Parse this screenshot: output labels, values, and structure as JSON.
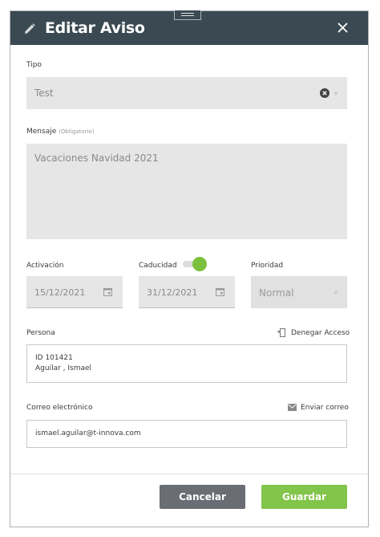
{
  "header": {
    "title": "Editar Aviso",
    "icon": "pencil-icon",
    "close_icon": "close-icon",
    "bg_color": "#3b4a52"
  },
  "tipo": {
    "label": "Tipo",
    "value": "Test"
  },
  "mensaje": {
    "label": "Mensaje",
    "hint": "(Obligatorio)",
    "value": "Vacaciones Navidad 2021"
  },
  "activacion": {
    "label": "Activación",
    "value": "15/12/2021"
  },
  "caducidad": {
    "label": "Caducidad",
    "value": "31/12/2021",
    "toggle_on": true
  },
  "prioridad": {
    "label": "Prioridad",
    "value": "Normal"
  },
  "persona": {
    "label": "Persona",
    "action_label": "Denegar Acceso",
    "action_icon": "deny-access-icon",
    "line1": "ID 101421",
    "line2": "Aguilar , Ismael"
  },
  "correo": {
    "label": "Correo electrónico",
    "action_label": "Enviar correo",
    "action_icon": "envelope-icon",
    "value": "ismael.aguilar@t-innova.com"
  },
  "footer": {
    "cancel_label": "Cancelar",
    "save_label": "Guardar",
    "cancel_color": "#6a6d73",
    "save_color": "#83c44a"
  }
}
